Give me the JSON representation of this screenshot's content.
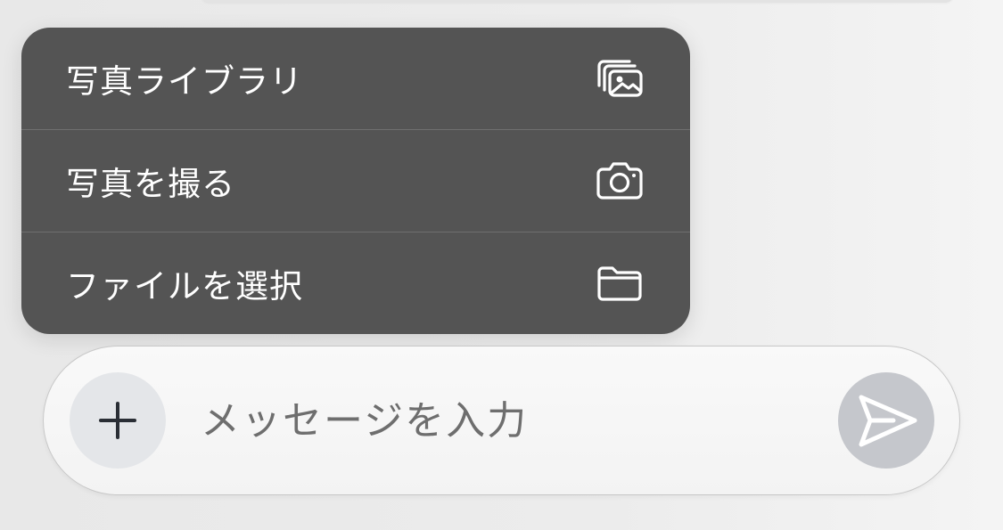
{
  "menu": {
    "items": [
      {
        "label": "写真ライブラリ",
        "icon": "photo-library-icon"
      },
      {
        "label": "写真を撮る",
        "icon": "camera-icon"
      },
      {
        "label": "ファイルを選択",
        "icon": "folder-icon"
      }
    ]
  },
  "composer": {
    "placeholder": "メッセージを入力",
    "value": "",
    "add_icon": "plus-icon",
    "send_icon": "send-icon"
  },
  "colors": {
    "menu_background": "#545454",
    "menu_text": "#ffffff",
    "add_button": "#e4e6e9",
    "send_button": "#c5c7cc",
    "placeholder_text": "#6e6e6e"
  }
}
